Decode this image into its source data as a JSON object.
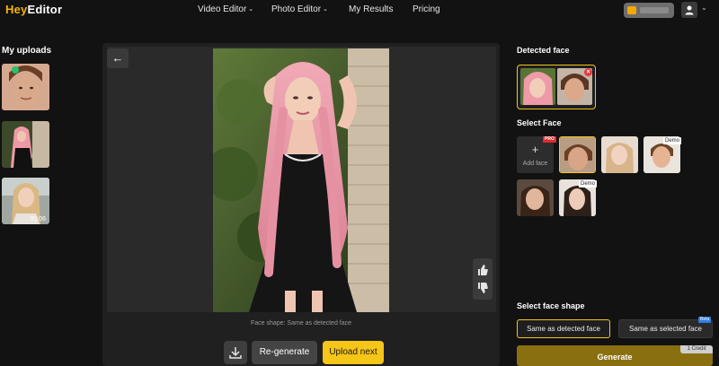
{
  "brand": {
    "logo_part1": "Hey",
    "logo_part2": "Editor"
  },
  "nav": {
    "items": [
      {
        "label": "Video Editor",
        "has_dropdown": true
      },
      {
        "label": "Photo Editor",
        "has_dropdown": true
      },
      {
        "label": "My Results",
        "has_dropdown": false
      },
      {
        "label": "Pricing",
        "has_dropdown": false
      }
    ],
    "chevron": "⌄"
  },
  "uploads": {
    "title": "My uploads",
    "items": [
      {
        "type": "image",
        "selected": true
      },
      {
        "type": "image",
        "selected": false
      },
      {
        "type": "video",
        "duration": "00:06"
      }
    ]
  },
  "preview": {
    "back_icon": "←",
    "caption": "Face shape: Same as detected face",
    "actions": {
      "regenerate": "Re-generate",
      "upload_next": "Upload next"
    }
  },
  "right": {
    "detected_title": "Detected face",
    "select_title": "Select Face",
    "add_face": {
      "plus": "+",
      "label": "Add face",
      "badge": "PRO"
    },
    "demo_badge": "Demo",
    "shape_title": "Select face shape",
    "shape_options": [
      "Same as detected face",
      "Same as selected face"
    ],
    "beta_badge": "Beta",
    "generate_label": "Generate",
    "credit_label": "1 Credit",
    "remove_icon": "×"
  },
  "colors": {
    "accent": "#f5c518",
    "background": "#121212",
    "panel": "#202020"
  }
}
